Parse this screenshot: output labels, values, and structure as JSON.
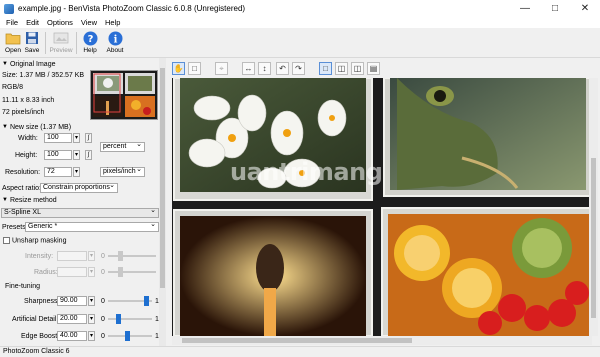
{
  "window": {
    "title": "example.jpg - BenVista PhotoZoom Classic 6.0.8 (Unregistered)"
  },
  "menu": [
    "File",
    "Edit",
    "Options",
    "View",
    "Help"
  ],
  "toolbar": {
    "open": "Open",
    "save": "Save",
    "preview": "Preview",
    "help": "Help",
    "about": "About"
  },
  "original_image": {
    "header": "Original Image",
    "size": "Size: 1.37 MB / 352.57 KB",
    "color": "RGB/8",
    "dimensions": "11.11 x 8.33 inch",
    "resolution": "72 pixels/inch"
  },
  "new_size": {
    "header": "New size (1.37 MB)",
    "width_label": "Width:",
    "width_value": "100",
    "height_label": "Height:",
    "height_value": "100",
    "unit": "percent",
    "resolution_label": "Resolution:",
    "resolution_value": "72",
    "resolution_unit": "pixels/inch",
    "aspect_label": "Aspect ratio:",
    "aspect_value": "Constrain proportions"
  },
  "resize_method": {
    "header": "Resize method",
    "method": "S-Spline XL",
    "presets_label": "Presets:",
    "presets_value": "Generic *",
    "unsharp_label": "Unsharp masking",
    "intensity_label": "Intensity:",
    "intensity_min": "0",
    "radius_label": "Radius:",
    "radius_min": "0"
  },
  "fine_tuning": {
    "header": "Fine-tuning",
    "sharpness_label": "Sharpness:",
    "sharpness_value": "90.00",
    "sharpness_min": "0",
    "sharpness_max": "1",
    "artificial_label": "Artificial Detail:",
    "artificial_value": "20.00",
    "artificial_min": "0",
    "artificial_max": "1",
    "edge_label": "Edge Boost:",
    "edge_value": "40.00",
    "edge_min": "0",
    "edge_max": "1"
  },
  "watermark": "uantrimang",
  "status": "PhotoZoom Classic 6",
  "colors": {
    "accent": "#1e6fd0",
    "preview_bg": "#1c1c1c"
  }
}
